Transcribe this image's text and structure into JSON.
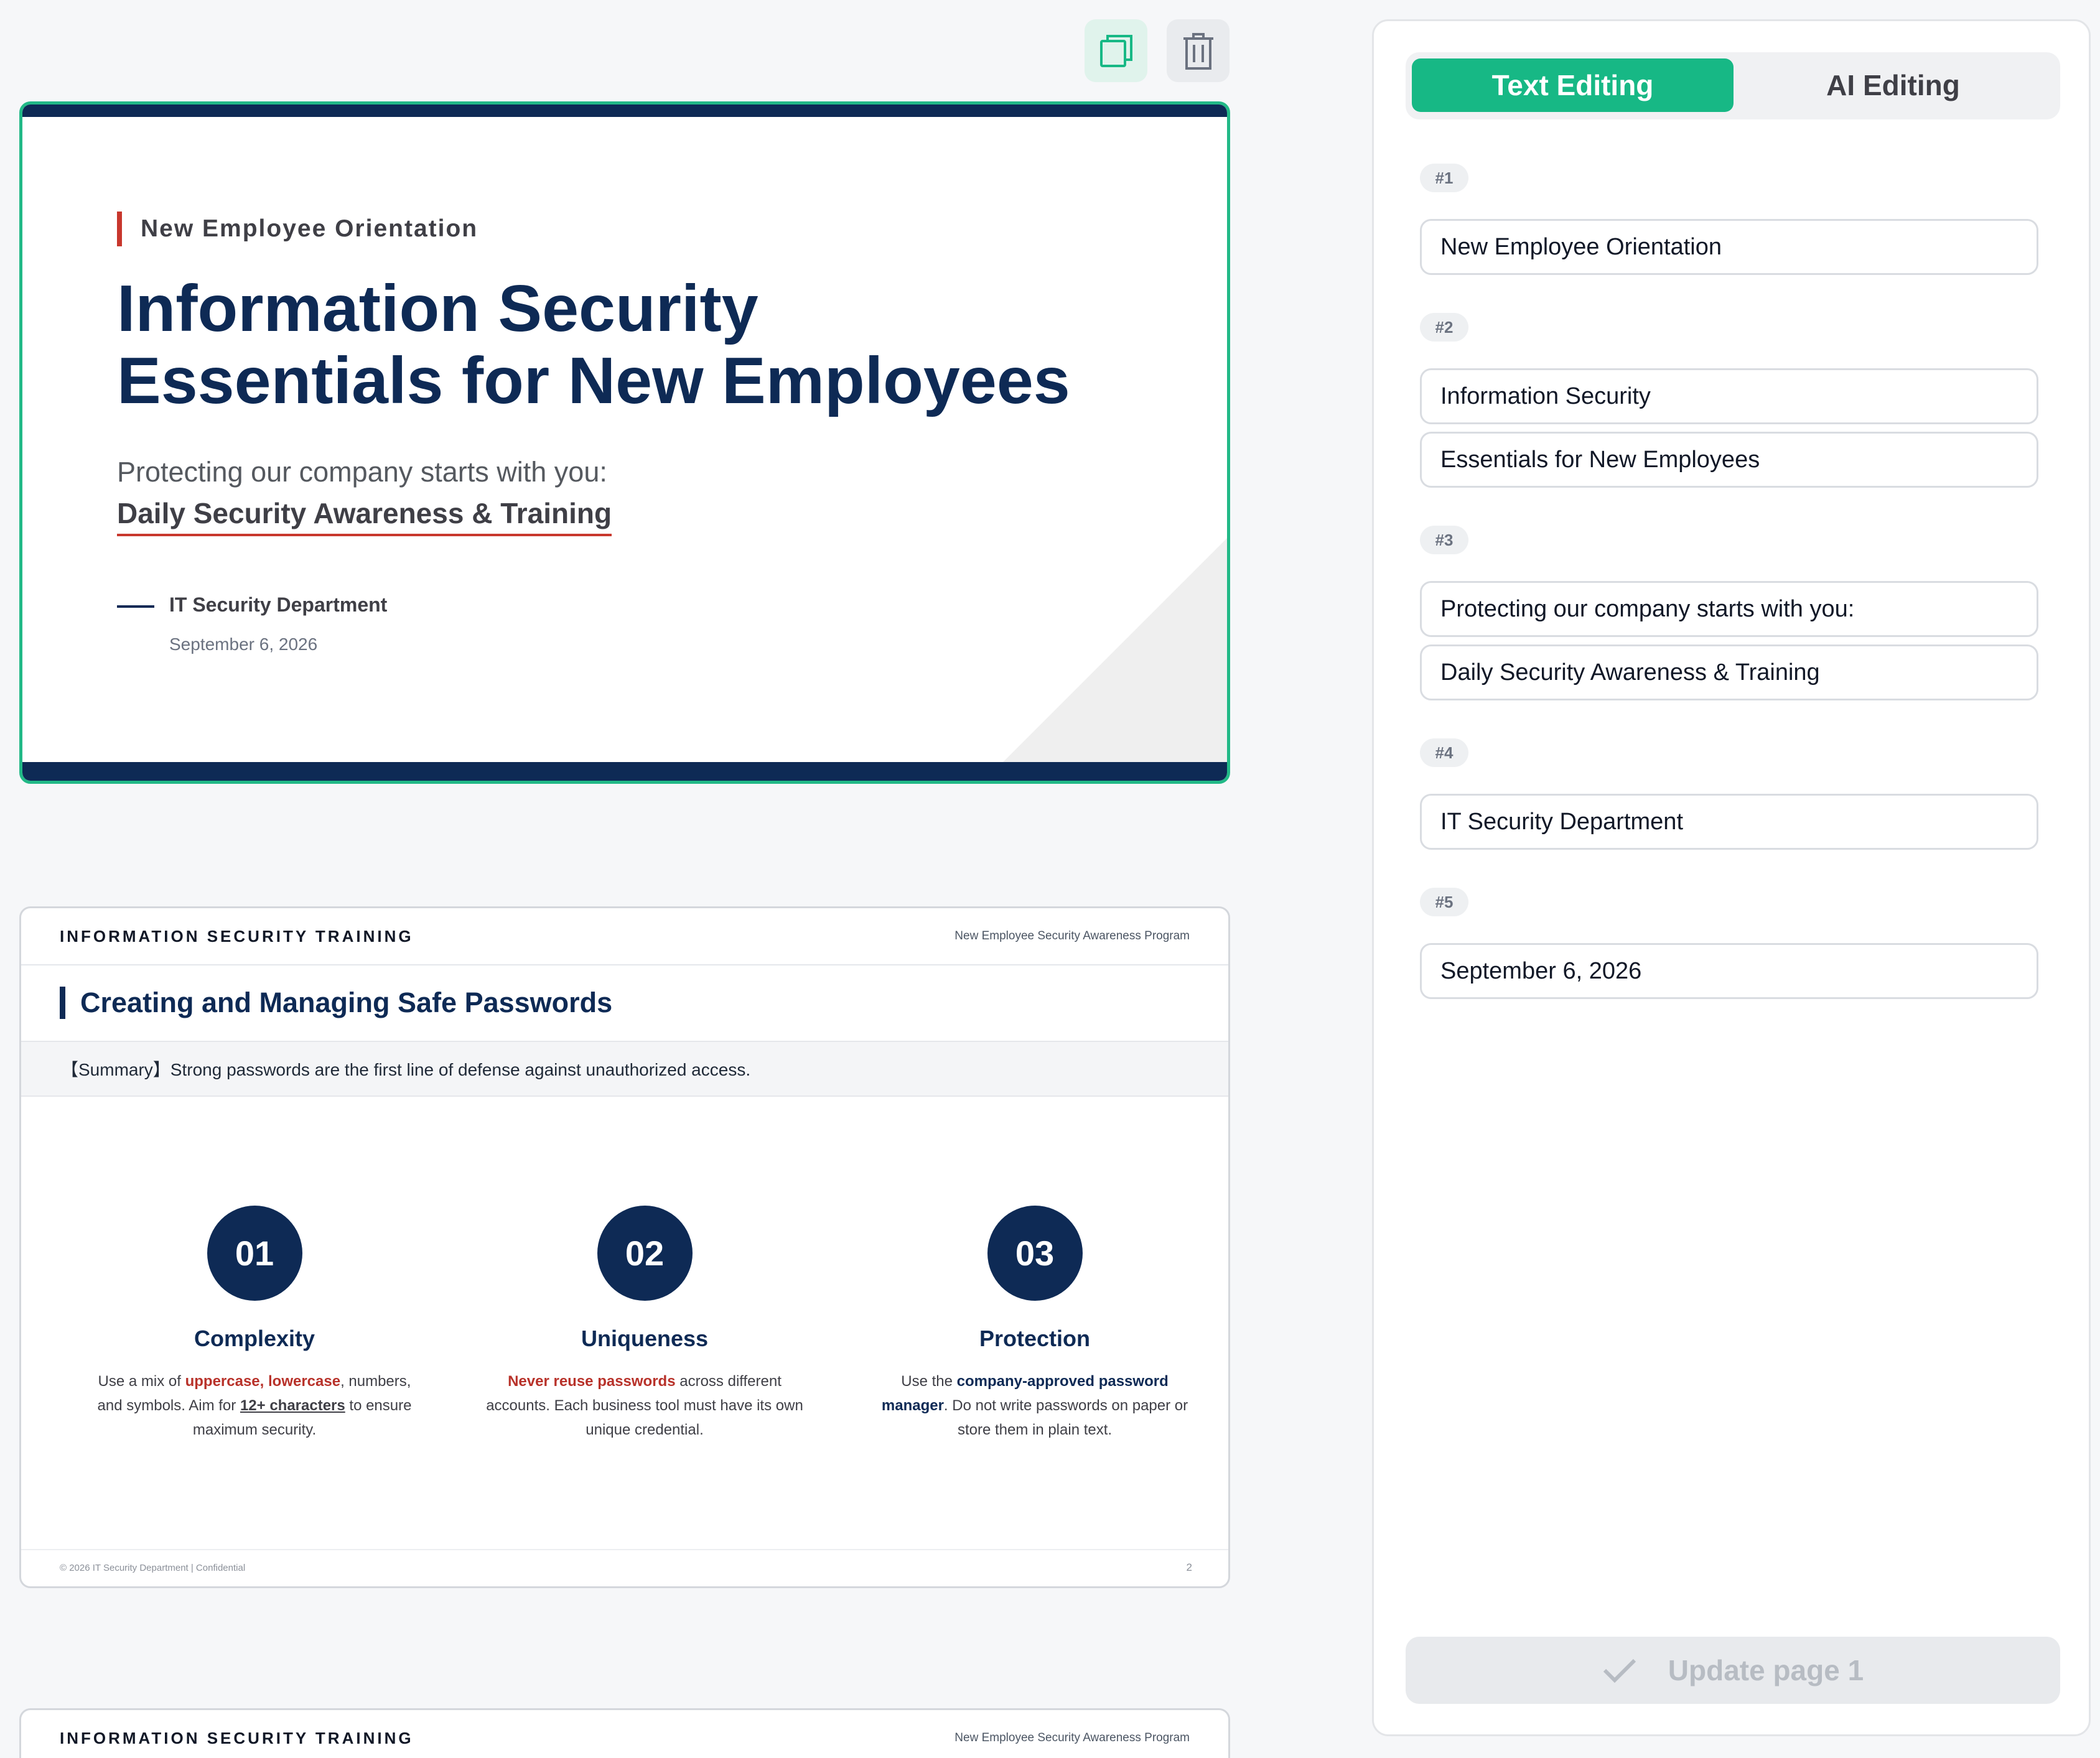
{
  "toolbar": {
    "duplicate_icon": "duplicate-icon",
    "delete_icon": "trash-icon"
  },
  "slide1": {
    "kicker": "New Employee Orientation",
    "title_line1": "Information Security",
    "title_line2": "Essentials for New Employees",
    "subtitle_line1": "Protecting our company starts with you:",
    "subtitle_line2": "Daily Security Awareness & Training",
    "department": "IT Security Department",
    "date": "September 6, 2026",
    "colors": {
      "navy": "#0e2a55",
      "accent_red": "#c8372d",
      "selected_border": "#22b987"
    }
  },
  "slide2": {
    "header_brand": "INFORMATION SECURITY TRAINING",
    "header_program": "New Employee Security Awareness Program",
    "title": "Creating and Managing Safe Passwords",
    "summary": "【Summary】Strong passwords are the first line of defense against unauthorized access.",
    "columns": [
      {
        "number": "01",
        "heading": "Complexity",
        "d1": "Use a mix of ",
        "d2": "uppercase, lowercase",
        "d3": ", numbers, and symbols. Aim for ",
        "d4": "12+ characters",
        "d5": " to ensure maximum security."
      },
      {
        "number": "02",
        "heading": "Uniqueness",
        "d1": "Never reuse passwords",
        "d2": " across different accounts. Each business tool must have its own unique credential."
      },
      {
        "number": "03",
        "heading": "Protection",
        "d1": "Use the ",
        "d2": "company-approved password manager",
        "d3": ". Do not write passwords on paper or store them in plain text."
      }
    ],
    "footer_copyright": "© 2026 IT Security Department | Confidential",
    "page_number": "2"
  },
  "slide3": {
    "header_brand": "INFORMATION SECURITY TRAINING",
    "header_program": "New Employee Security Awareness Program"
  },
  "panel": {
    "tabs": [
      {
        "label": "Text Editing",
        "active": true
      },
      {
        "label": "AI Editing",
        "active": false
      }
    ],
    "groups": [
      {
        "badge": "#1",
        "fields": [
          "New Employee Orientation"
        ]
      },
      {
        "badge": "#2",
        "fields": [
          "Information Security",
          "Essentials for New Employees"
        ]
      },
      {
        "badge": "#3",
        "fields": [
          "Protecting our company starts with you:",
          "Daily Security Awareness & Training"
        ]
      },
      {
        "badge": "#4",
        "fields": [
          "IT Security Department"
        ]
      },
      {
        "badge": "#5",
        "fields": [
          "September 6, 2026"
        ]
      }
    ],
    "update_button": "Update page 1",
    "accent_color": "#17b885"
  }
}
